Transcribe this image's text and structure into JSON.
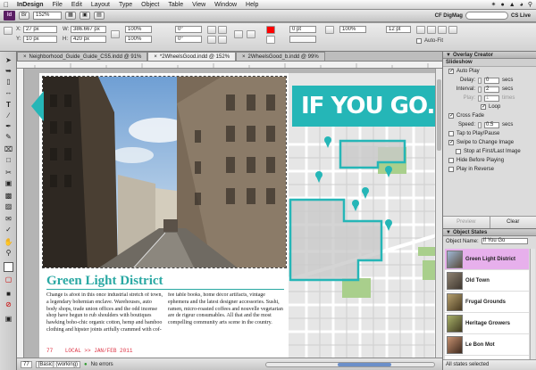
{
  "menubar": {
    "app_name": "InDesign",
    "items": [
      "File",
      "Edit",
      "Layout",
      "Type",
      "Object",
      "Table",
      "View",
      "Window",
      "Help"
    ],
    "right_icons": [
      "bluetooth-icon",
      "wifi-icon",
      "volume-icon",
      "clock-icon",
      "search-icon"
    ]
  },
  "appbar": {
    "logo": "Id",
    "zoom": "152%",
    "workspace": "CF DigMag",
    "cs_live": "CS Live"
  },
  "control": {
    "x": "27 px",
    "y": "10 px",
    "w": "386.667 px",
    "h": "420 px",
    "scale_x": "100%",
    "scale_y": "100%",
    "rotate": "0°",
    "shear": "0°",
    "stroke": "0 pt",
    "size": "12 pt",
    "opacity": "100%",
    "auto_fit": "Auto-Fit"
  },
  "tabs": [
    {
      "label": "Neighborhood_Guide_Guide_CS5.indd @ 91%",
      "active": false
    },
    {
      "label": "*2WheelsGood.indd @ 152%",
      "active": true
    },
    {
      "label": "2WheelsGood_b.indd @ 99%",
      "active": false
    }
  ],
  "page": {
    "banner": "IF YOU GO...",
    "heading": "Green Light District",
    "col1": "Change is afoot in this once industrial stretch of town, a legendary bohemian enclave. Warehouses, auto body shops, trade union offices and the odd incense shop have begun to rub shoulders with boutiques hawking boho-chic organic cotton, hemp and bamboo clothing and hipster joints artfully crammed with cof-",
    "col2": "fee table books, home décor artifacts, vintage ephemera and the latest designer accessories. Sushi, ramen, micro-roasted coffees and nouvelle vegetarian are de rigeur consumables. All that and the most compelling community arts scene in the country.",
    "folio": "77",
    "footer": "LOCAL >> JAN/FEB 2011"
  },
  "status": {
    "page": "77",
    "profile": "[Basic] (working)",
    "errors": "No errors"
  },
  "overlay": {
    "title": "Overlay Creator",
    "section": "Slideshow",
    "auto_play": "Auto Play",
    "delay_label": "Delay:",
    "delay": "0",
    "interval_label": "Interval:",
    "interval": "2",
    "play_label": "Play:",
    "play": "1",
    "unit_secs": "secs",
    "unit_times": "times",
    "loop": "Loop",
    "cross_fade": "Cross Fade",
    "speed_label": "Speed:",
    "speed": "0.5",
    "tap": "Tap to Play/Pause",
    "swipe": "Swipe to Change Image",
    "stop": "Stop at First/Last Image",
    "hide": "Hide Before Playing",
    "reverse": "Play in Reverse",
    "btn_preview": "Preview",
    "btn_clear": "Clear"
  },
  "states": {
    "title": "Object States",
    "name_label": "Object Name:",
    "name": "If You Go",
    "items": [
      {
        "label": "Green Light District",
        "selected": true
      },
      {
        "label": "Old Town",
        "selected": false
      },
      {
        "label": "Frugal Grounds",
        "selected": false
      },
      {
        "label": "Heritage Growers",
        "selected": false
      },
      {
        "label": "Le Bon Mot",
        "selected": false
      }
    ],
    "status": "All states selected"
  },
  "colors": {
    "accent_teal": "#25b6b7",
    "selected_state": "#e7b0ec",
    "footer_red": "#d34455"
  }
}
